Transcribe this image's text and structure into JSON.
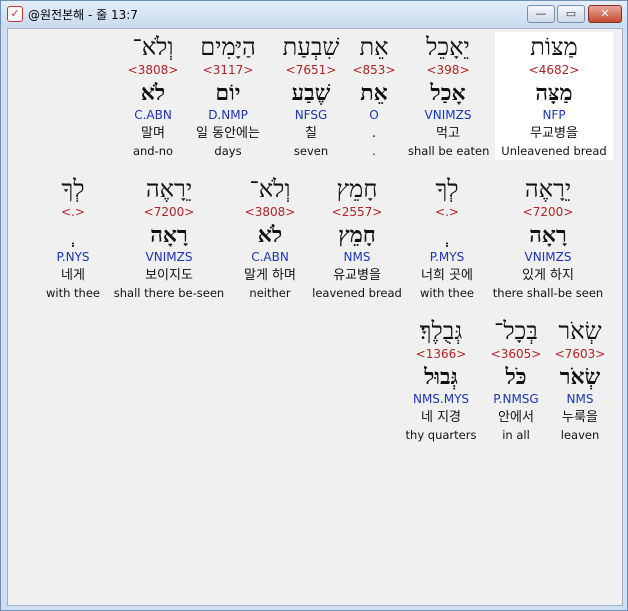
{
  "window": {
    "title": "@원전본해 - 줄 13:7",
    "minimize": "—",
    "maximize": "▭",
    "close": "✕"
  },
  "rows": [
    {
      "cells": [
        {
          "heb": "מַצּוֹת",
          "strong": "<4682>",
          "root": "מַצָּה",
          "morph": "NFP",
          "kor": "무교병을",
          "eng": "Unleavened bread",
          "highlight": true
        },
        {
          "heb": "יֵאָכֵל",
          "strong": "<398>",
          "root": "אָכַל",
          "morph": "VNIMZS",
          "kor": "먹고",
          "eng": "shall be eaten"
        },
        {
          "heb": "אֵת",
          "strong": "<853>",
          "root": "אֵת",
          "morph": "O",
          "kor": ".",
          "eng": "."
        },
        {
          "heb": "שִׁבְעַת",
          "strong": "<7651>",
          "root": "שֶׁבַע",
          "morph": "NFSG",
          "kor": "칠",
          "eng": "seven"
        },
        {
          "heb": "הַיָּמִים",
          "strong": "<3117>",
          "root": "יוֹם",
          "morph": "D.NMP",
          "kor": "일 동안에는",
          "eng": "days"
        },
        {
          "heb": "וְלֹא־",
          "strong": "<3808>",
          "root": "לֹא",
          "morph": "C.ABN",
          "kor": "말며",
          "eng": "and-no"
        }
      ]
    },
    {
      "cells": [
        {
          "heb": "יֵרָאֶה",
          "strong": "<7200>",
          "root": "רָאָה",
          "morph": "VNIMZS",
          "kor": "있게 하지",
          "eng": "there shall-be seen"
        },
        {
          "heb": "לְךָ",
          "strong": "<.>",
          "root": "ְ",
          "morph": "P.MYS",
          "kor": "너희 곳에",
          "eng": "with thee"
        },
        {
          "heb": "חָמֵץ",
          "strong": "<2557>",
          "root": "חָמֵץ",
          "morph": "NMS",
          "kor": "유교병을",
          "eng": "leavened bread"
        },
        {
          "heb": "וְלֹא־",
          "strong": "<3808>",
          "root": "לֹא",
          "morph": "C.ABN",
          "kor": "말게 하며",
          "eng": "neither"
        },
        {
          "heb": "יֵרָאֶה",
          "strong": "<7200>",
          "root": "רָאָה",
          "morph": "VNIMZS",
          "kor": "보이지도",
          "eng": "shall there be-seen"
        },
        {
          "heb": "לְךָ",
          "strong": "<.>",
          "root": "ְ",
          "morph": "P.NYS",
          "kor": "네게",
          "eng": "with thee"
        }
      ]
    },
    {
      "cells": [
        {
          "heb": "שְׂאֹר",
          "strong": "<7603>",
          "root": "שְׂאֹר",
          "morph": "NMS",
          "kor": "누룩을",
          "eng": "leaven"
        },
        {
          "heb": "בְּכָל־",
          "strong": "<3605>",
          "root": "כֹּל",
          "morph": "P.NMSG",
          "kor": "안에서",
          "eng": "in all"
        },
        {
          "heb": "גְּבֻלֶךָ׃",
          "strong": "<1366>",
          "root": "גְּבוּל",
          "morph": "NMS.MYS",
          "kor": "네 지경",
          "eng": "thy quarters"
        }
      ]
    }
  ]
}
